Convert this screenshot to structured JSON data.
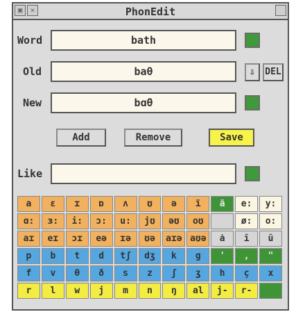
{
  "window": {
    "title": "PhonEdit"
  },
  "word": {
    "label": "Word",
    "value": "bath"
  },
  "old": {
    "label": "Old",
    "value": "baθ",
    "arrow": "⇩",
    "del_label": "DEL"
  },
  "new": {
    "label": "New",
    "value": "bɑ̃θ"
  },
  "buttons": {
    "add": "Add",
    "remove": "Remove",
    "save": "Save"
  },
  "like": {
    "label": "Like",
    "value": ""
  },
  "colors": {
    "orange": "#f2b15e",
    "blue": "#56a7df",
    "yellow": "#f2ec43",
    "green": "#3f9437",
    "field": "#fbf7ea"
  },
  "keyboard": [
    [
      {
        "s": "a",
        "c": "orange"
      },
      {
        "s": "ɛ",
        "c": "orange"
      },
      {
        "s": "ɪ",
        "c": "orange"
      },
      {
        "s": "ɒ",
        "c": "orange"
      },
      {
        "s": "ʌ",
        "c": "orange"
      },
      {
        "s": "ʊ",
        "c": "orange"
      },
      {
        "s": "ə",
        "c": "orange"
      },
      {
        "s": "ï",
        "c": "orange"
      },
      {
        "s": "ä",
        "c": "green"
      },
      {
        "s": "e:",
        "c": "cream"
      },
      {
        "s": "y:",
        "c": "cream"
      }
    ],
    [
      {
        "s": "ɑ:",
        "c": "orange"
      },
      {
        "s": "ɜ:",
        "c": "orange"
      },
      {
        "s": "i:",
        "c": "orange"
      },
      {
        "s": "ɔ:",
        "c": "orange"
      },
      {
        "s": "u:",
        "c": "orange"
      },
      {
        "s": "jʊ",
        "c": "orange"
      },
      {
        "s": "əʊ",
        "c": "orange"
      },
      {
        "s": "oʊ",
        "c": "orange"
      },
      {
        "s": "",
        "c": "grey"
      },
      {
        "s": "ø:",
        "c": "cream"
      },
      {
        "s": "o:",
        "c": "cream"
      }
    ],
    [
      {
        "s": "aɪ",
        "c": "orange"
      },
      {
        "s": "eɪ",
        "c": "orange"
      },
      {
        "s": "ɔɪ",
        "c": "orange"
      },
      {
        "s": "eə",
        "c": "orange"
      },
      {
        "s": "ɪə",
        "c": "orange"
      },
      {
        "s": "ʊə",
        "c": "orange"
      },
      {
        "s": "aɪə",
        "c": "orange"
      },
      {
        "s": "aʊə",
        "c": "orange"
      },
      {
        "s": "ȧ",
        "c": "grey"
      },
      {
        "s": "ȋ",
        "c": "grey"
      },
      {
        "s": "ȗ",
        "c": "grey"
      }
    ],
    [
      {
        "s": "p",
        "c": "blue"
      },
      {
        "s": "b",
        "c": "blue"
      },
      {
        "s": "t",
        "c": "blue"
      },
      {
        "s": "d",
        "c": "blue"
      },
      {
        "s": "tʃ",
        "c": "blue"
      },
      {
        "s": "dʒ",
        "c": "blue"
      },
      {
        "s": "k",
        "c": "blue"
      },
      {
        "s": "g",
        "c": "blue"
      },
      {
        "s": "'",
        "c": "green"
      },
      {
        "s": ",",
        "c": "green"
      },
      {
        "s": "\"",
        "c": "green"
      }
    ],
    [
      {
        "s": "f",
        "c": "blue"
      },
      {
        "s": "v",
        "c": "blue"
      },
      {
        "s": "θ",
        "c": "blue"
      },
      {
        "s": "ð",
        "c": "blue"
      },
      {
        "s": "s",
        "c": "blue"
      },
      {
        "s": "z",
        "c": "blue"
      },
      {
        "s": "ʃ",
        "c": "blue"
      },
      {
        "s": "ʒ",
        "c": "blue"
      },
      {
        "s": "h",
        "c": "blue"
      },
      {
        "s": "ç",
        "c": "blue"
      },
      {
        "s": "x",
        "c": "blue"
      }
    ],
    [
      {
        "s": "r",
        "c": "yellow"
      },
      {
        "s": "l",
        "c": "yellow"
      },
      {
        "s": "w",
        "c": "yellow"
      },
      {
        "s": "j",
        "c": "yellow"
      },
      {
        "s": "m",
        "c": "yellow"
      },
      {
        "s": "n",
        "c": "yellow"
      },
      {
        "s": "ŋ",
        "c": "yellow"
      },
      {
        "s": "al",
        "c": "yellow"
      },
      {
        "s": "j-",
        "c": "yellow"
      },
      {
        "s": "r-",
        "c": "yellow"
      },
      {
        "s": "",
        "c": "green"
      }
    ]
  ]
}
